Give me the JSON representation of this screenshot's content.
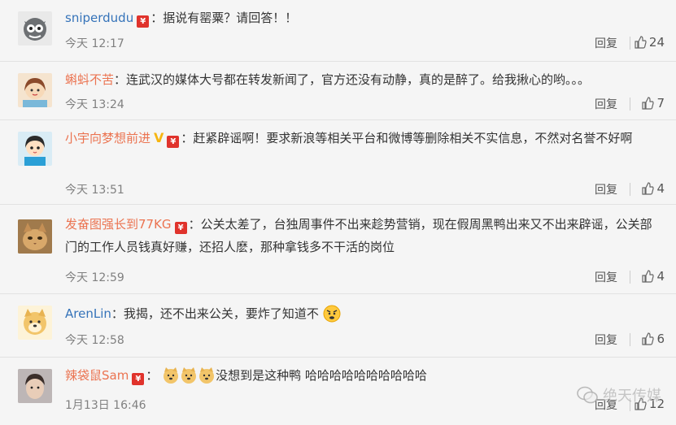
{
  "comments": [
    {
      "user": "sniperdudu",
      "text": "：据说有罂粟？请回答！！",
      "time": "今天 12:17",
      "reply": "回复",
      "likes": "24"
    },
    {
      "user": "蝌蚪不苦",
      "text": "：连武汉的媒体大号都在转发新闻了，官方还没有动静，真的是醉了。给我揪心的哟。。。",
      "time": "今天 13:24",
      "reply": "回复",
      "likes": "7"
    },
    {
      "user": "小宇向梦想前进",
      "text": "：赶紧辟谣啊！要求新浪等相关平台和微博等删除相关不实信息，不然对名誉不好啊",
      "time": "今天 13:51",
      "reply": "回复",
      "likes": "4"
    },
    {
      "user": "发奋图强长到77KG",
      "text": "：公关太差了，台独周事件不出来趁势营销，现在假周黑鸭出来又不出来辟谣，公关部门的工作人员钱真好赚，还招人麽，那种拿钱多不干活的岗位",
      "time": "今天 12:59",
      "reply": "回复",
      "likes": "4"
    },
    {
      "user": "ArenLin",
      "text": "：我揭，还不出来公关，要炸了知道不",
      "time": "今天 12:58",
      "reply": "回复",
      "likes": "6"
    },
    {
      "user": "辣袋鼠Sam",
      "text": "没想到是这种鸭 哈哈哈哈哈哈哈哈哈哈",
      "time": "1月13日 16:46",
      "reply": "回复",
      "likes": "12"
    }
  ],
  "vip_badge": "¥",
  "watermark": "绝天传媒",
  "colors": {
    "name": "#eb7350",
    "name_blue": "#3573b9",
    "vip": "#e0332c"
  }
}
